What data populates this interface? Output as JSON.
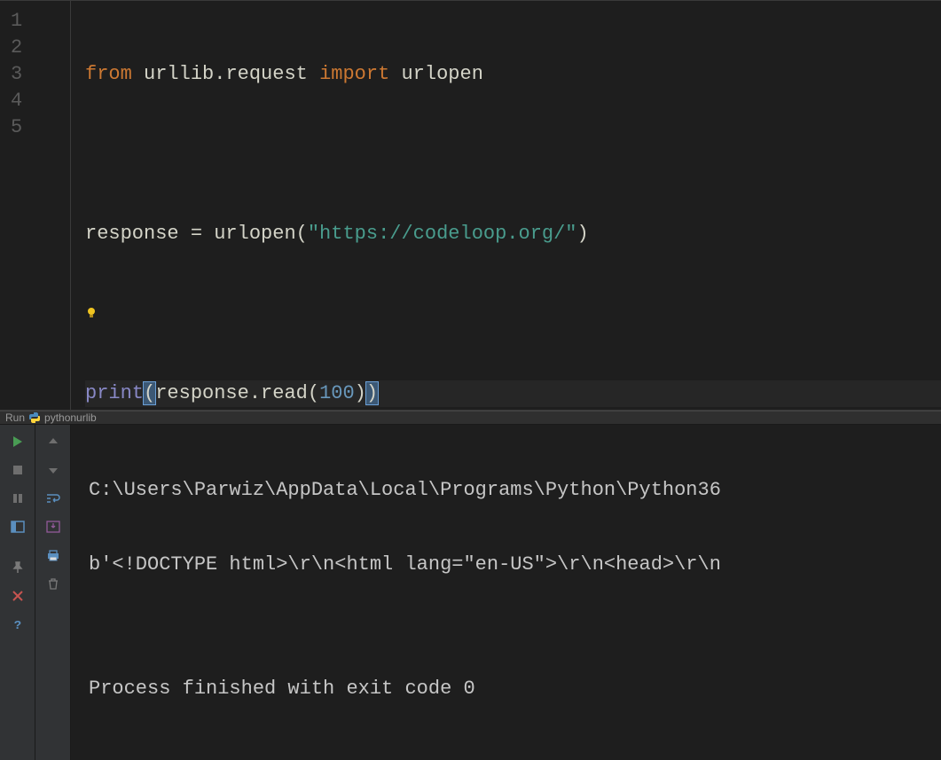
{
  "editor": {
    "lines": {
      "l1_from": "from",
      "l1_mod1": "urllib",
      "l1_dot": ".",
      "l1_mod2": "request",
      "l1_import": "import",
      "l1_mod3": "urlopen",
      "l3_response": "response",
      "l3_eq": "=",
      "l3_urlopen": "urlopen",
      "l3_lp": "(",
      "l3_str": "\"https://codeloop.org/\"",
      "l3_rp": ")",
      "l5_print": "print",
      "l5_lp": "(",
      "l5_resp": "response",
      "l5_dot": ".",
      "l5_read": "read",
      "l5_lp2": "(",
      "l5_num": "100",
      "l5_rp2": ")",
      "l5_rp": ")"
    },
    "gutter": [
      "1",
      "2",
      "3",
      "4",
      "5"
    ]
  },
  "run": {
    "tab_label": "Run",
    "config_name": "pythonurlib",
    "console_lines": [
      "C:\\Users\\Parwiz\\AppData\\Local\\Programs\\Python\\Python36",
      "b'<!DOCTYPE html>\\r\\n<html lang=\"en-US\">\\r\\n<head>\\r\\n",
      "",
      "Process finished with exit code 0"
    ]
  },
  "icons": {
    "bulb": "lightbulb-icon",
    "run": "play-icon",
    "stop": "stop-icon",
    "pause": "pause-icon",
    "layout": "layout-icon",
    "pin": "pin-icon",
    "close": "close-icon",
    "help": "help-icon",
    "up": "up-arrow-icon",
    "down": "down-arrow-icon",
    "wrap": "soft-wrap-icon",
    "scroll": "scroll-to-end-icon",
    "print_out": "print-icon",
    "trash": "trash-icon",
    "python": "python-icon"
  }
}
